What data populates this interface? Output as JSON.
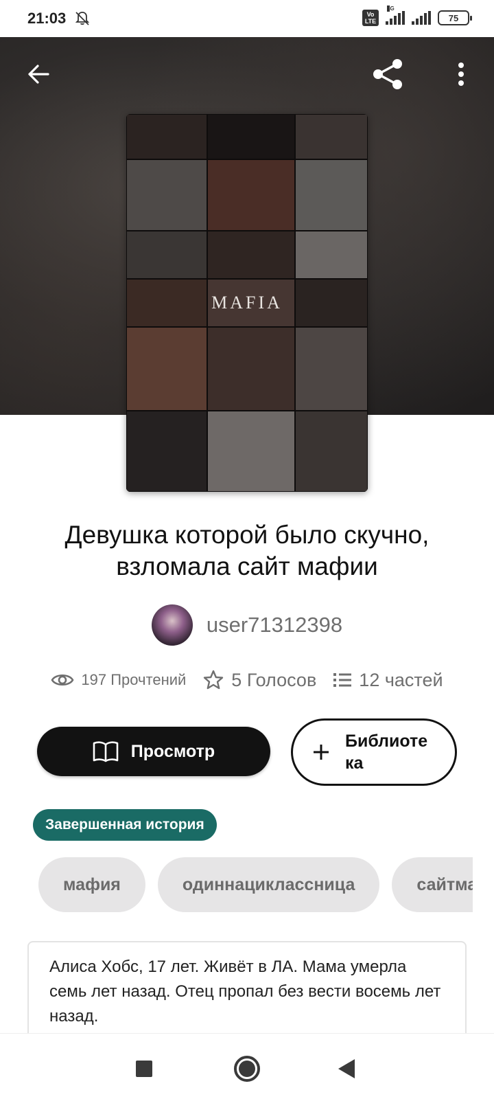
{
  "status_bar": {
    "time": "21:03",
    "network_label": "4G",
    "volte_label": "Vo LTE",
    "battery": "75"
  },
  "cover": {
    "title_text": "MAFIA"
  },
  "story": {
    "title": "Девушка которой было скучно, взломала сайт мафии",
    "author": "user71312398",
    "reads": "197 Прочтений",
    "votes": "5 Голосов",
    "parts": "12 частей"
  },
  "actions": {
    "view_label": "Просмотр",
    "library_label": "Библиотека"
  },
  "badge": "Завершенная история",
  "tags": [
    "мафия",
    "одиннациклассница",
    "сайтмафии"
  ],
  "description": "Алиса Хобс, 17 лет. Живёт в ЛА. Мама умерла семь лет назад. Отец пропал без вести восемь лет назад.",
  "icons": {
    "back": "arrow-left-icon",
    "share": "share-icon",
    "more": "more-vertical-icon",
    "reads": "eye-icon",
    "votes": "star-icon",
    "parts": "list-icon",
    "view": "book-open-icon",
    "library": "plus-icon"
  },
  "colors": {
    "badge_bg": "#1a6b65",
    "primary_button_bg": "#121212",
    "tag_bg": "#e6e5e6"
  }
}
